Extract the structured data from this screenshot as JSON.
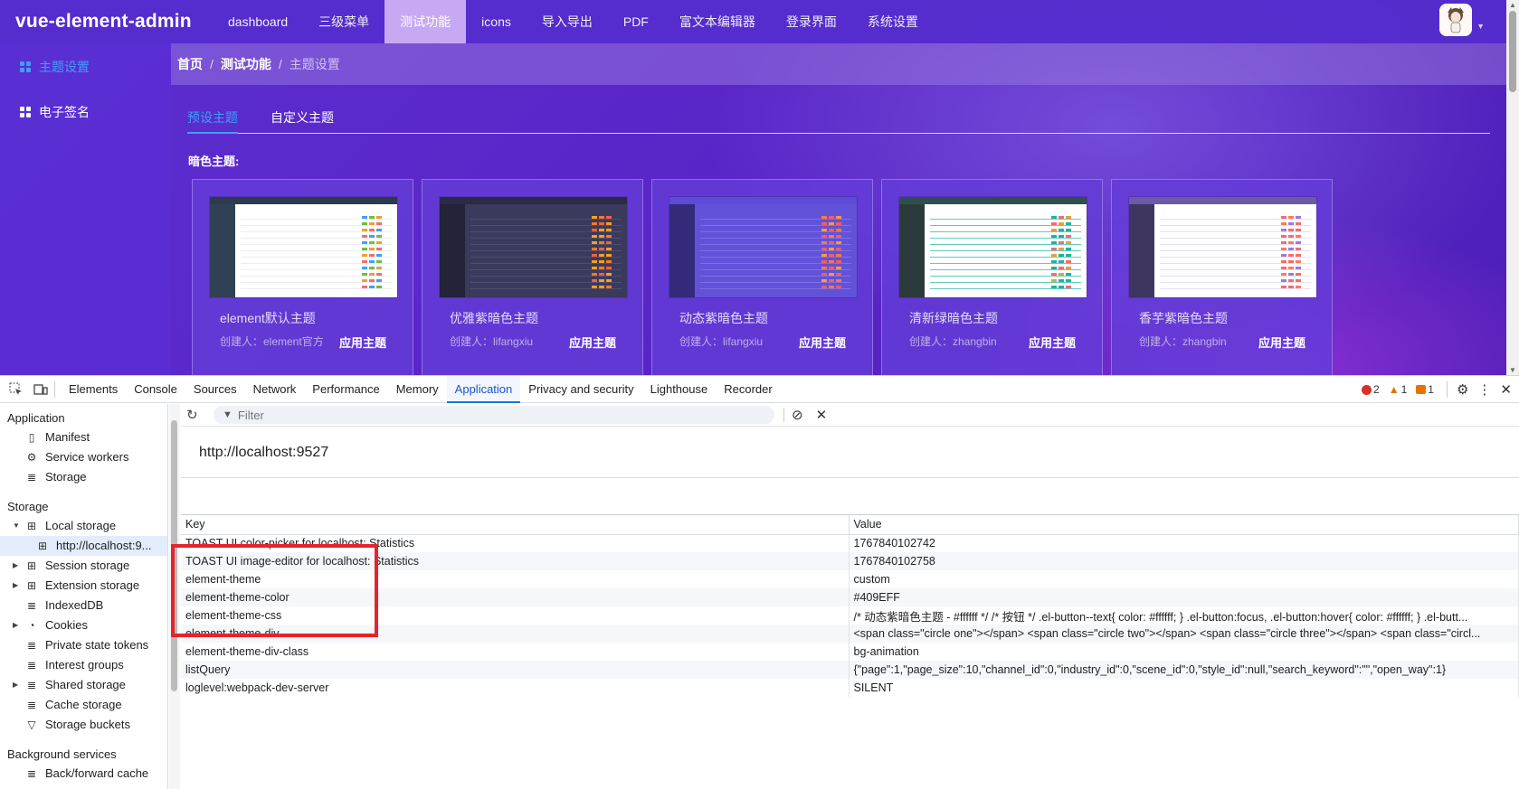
{
  "app": {
    "logo": "vue-element-admin",
    "menu": [
      "dashboard",
      "三级菜单",
      "测试功能",
      "icons",
      "导入导出",
      "PDF",
      "富文本编辑器",
      "登录界面",
      "系统设置"
    ],
    "active_menu": "测试功能",
    "sidebar": [
      {
        "label": "主题设置",
        "active": true
      },
      {
        "label": "电子签名",
        "active": false
      }
    ],
    "breadcrumb": [
      "首页",
      "测试功能",
      "主题设置"
    ],
    "breadcrumb_sep": "/",
    "tabs": [
      {
        "label": "预设主题",
        "active": true
      },
      {
        "label": "自定义主题",
        "active": false
      }
    ],
    "section_title": "暗色主题:",
    "cards": [
      {
        "name": "element默认主题",
        "creator": "创建人：element官方",
        "apply": "应用主题",
        "style": "light"
      },
      {
        "name": "优雅紫暗色主题",
        "creator": "创建人：lifangxiu",
        "apply": "应用主题",
        "style": "dark"
      },
      {
        "name": "动态紫暗色主题",
        "creator": "创建人：lifangxiu",
        "apply": "应用主题",
        "style": "purple"
      },
      {
        "name": "清新绿暗色主题",
        "creator": "创建人：zhangbin",
        "apply": "应用主题",
        "style": "green"
      },
      {
        "name": "香芋紫暗色主题",
        "creator": "创建人：zhangbin",
        "apply": "应用主题",
        "style": "taro"
      }
    ]
  },
  "devtools": {
    "tabs": [
      "Elements",
      "Console",
      "Sources",
      "Network",
      "Performance",
      "Memory",
      "Application",
      "Privacy and security",
      "Lighthouse",
      "Recorder"
    ],
    "active_tab": "Application",
    "counts": {
      "errors": "2",
      "warnings": "1",
      "issues": "1"
    },
    "sidebar": {
      "application_header": "Application",
      "application_items": [
        "Manifest",
        "Service workers",
        "Storage"
      ],
      "storage_header": "Storage",
      "storage_items": [
        "Local storage",
        "http://localhost:9...",
        "Session storage",
        "Extension storage",
        "IndexedDB",
        "Cookies",
        "Private state tokens",
        "Interest groups",
        "Shared storage",
        "Cache storage",
        "Storage buckets"
      ],
      "background_header": "Background services",
      "background_items": [
        "Back/forward cache"
      ]
    },
    "filter_placeholder": "Filter",
    "origin": "http://localhost:9527",
    "columns": [
      "Key",
      "Value"
    ],
    "rows": [
      {
        "key": "TOAST UI color-picker for localhost: Statistics",
        "value": "1767840102742"
      },
      {
        "key": "TOAST UI image-editor for localhost: Statistics",
        "value": "1767840102758"
      },
      {
        "key": "element-theme",
        "value": "custom"
      },
      {
        "key": "element-theme-color",
        "value": "#409EFF"
      },
      {
        "key": "element-theme-css",
        "value": "/* 动态紫暗色主题 - #ffffff */ /* 按钮 */ .el-button--text{ color: #ffffff; } .el-button:focus, .el-button:hover{ color: #ffffff; } .el-butt..."
      },
      {
        "key": "element-theme-div",
        "value": "<span class=\"circle one\"></span> <span class=\"circle two\"></span> <span class=\"circle three\"></span> <span class=\"circl..."
      },
      {
        "key": "element-theme-div-class",
        "value": "bg-animation"
      },
      {
        "key": "listQuery",
        "value": "{\"page\":1,\"page_size\":10,\"channel_id\":0,\"industry_id\":0,\"scene_id\":0,\"style_id\":null,\"search_keyword\":\"\",\"open_way\":1}"
      },
      {
        "key": "loglevel:webpack-dev-server",
        "value": "SILENT"
      }
    ]
  },
  "colors": {
    "accent": "#409eff",
    "highlight": "#e8232a",
    "devtools_active": "#1a73e8"
  }
}
